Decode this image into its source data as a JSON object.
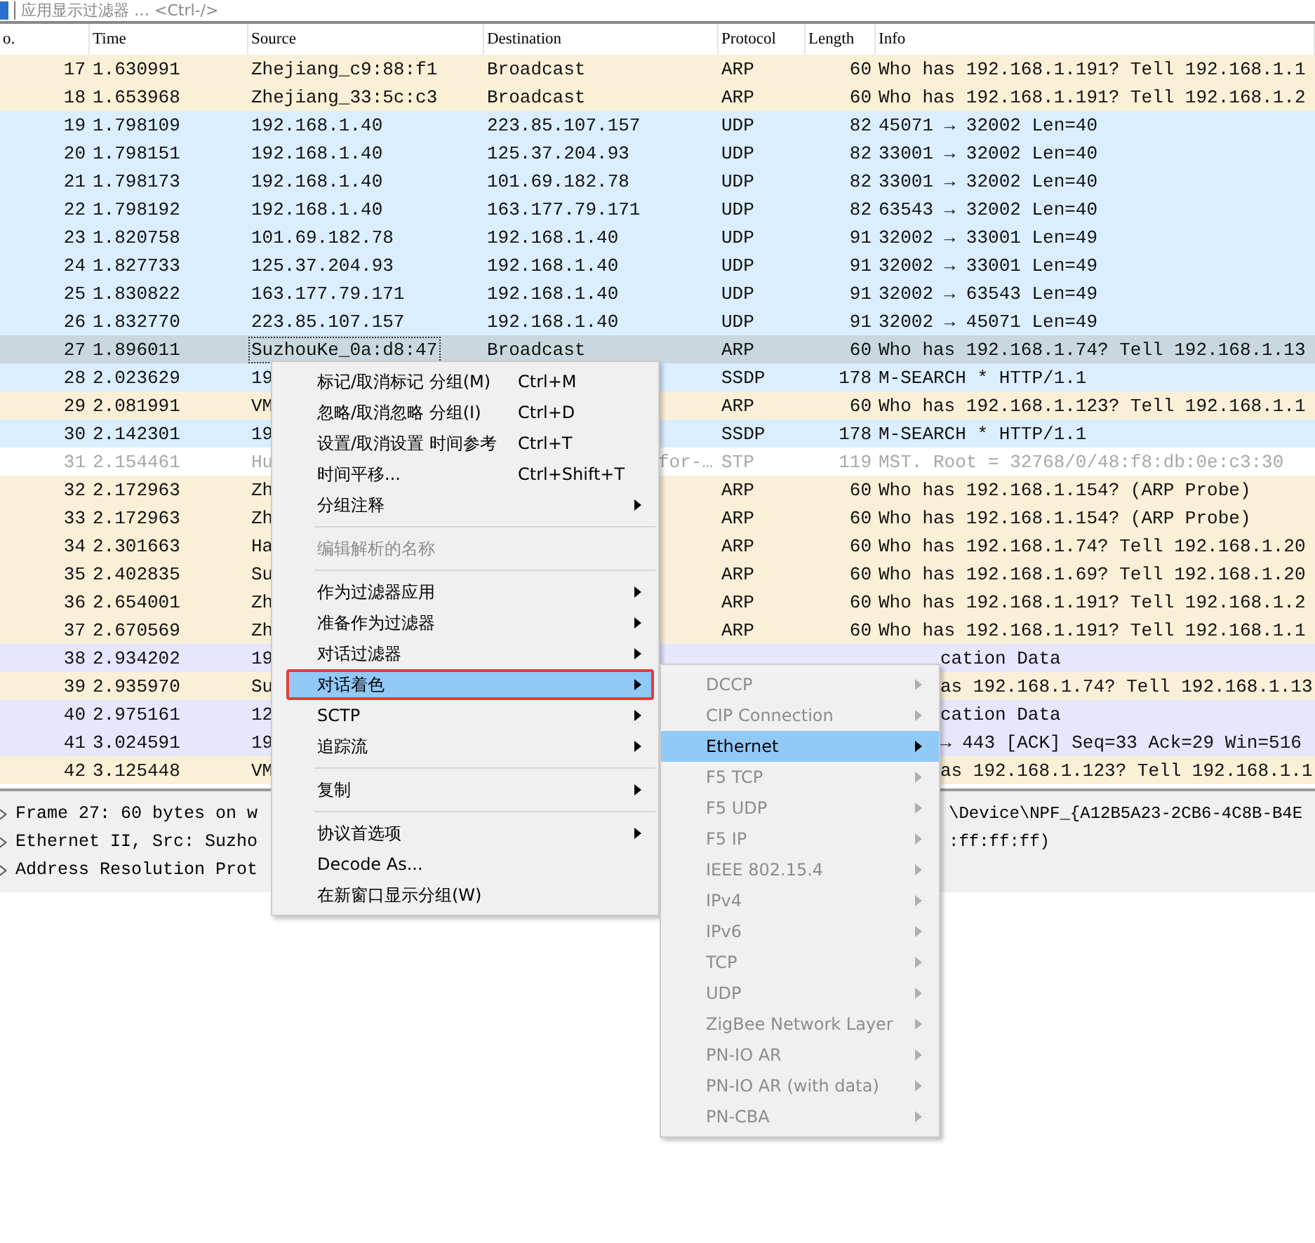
{
  "filter": {
    "placeholder": "应用显示过滤器 … <Ctrl-/>"
  },
  "columns": [
    "o.",
    "Time",
    "Source",
    "Destination",
    "Protocol",
    "Length",
    "Info"
  ],
  "rows": [
    {
      "no": "17",
      "time": "1.630991",
      "source": "Zhejiang_c9:88:f1",
      "destination": "Broadcast",
      "protocol": "ARP",
      "length": "60",
      "info": "Who has 192.168.1.191? Tell 192.168.1.1",
      "color": "#faf0d7",
      "selected": false,
      "dimmed": false
    },
    {
      "no": "18",
      "time": "1.653968",
      "source": "Zhejiang_33:5c:c3",
      "destination": "Broadcast",
      "protocol": "ARP",
      "length": "60",
      "info": "Who has 192.168.1.191? Tell 192.168.1.2",
      "color": "#faf0d7",
      "selected": false,
      "dimmed": false
    },
    {
      "no": "19",
      "time": "1.798109",
      "source": "192.168.1.40",
      "destination": "223.85.107.157",
      "protocol": "UDP",
      "length": "82",
      "info": "45071 → 32002 Len=40",
      "color": "#daeeff",
      "selected": false,
      "dimmed": false
    },
    {
      "no": "20",
      "time": "1.798151",
      "source": "192.168.1.40",
      "destination": "125.37.204.93",
      "protocol": "UDP",
      "length": "82",
      "info": "33001 → 32002 Len=40",
      "color": "#daeeff",
      "selected": false,
      "dimmed": false
    },
    {
      "no": "21",
      "time": "1.798173",
      "source": "192.168.1.40",
      "destination": "101.69.182.78",
      "protocol": "UDP",
      "length": "82",
      "info": "33001 → 32002 Len=40",
      "color": "#daeeff",
      "selected": false,
      "dimmed": false
    },
    {
      "no": "22",
      "time": "1.798192",
      "source": "192.168.1.40",
      "destination": "163.177.79.171",
      "protocol": "UDP",
      "length": "82",
      "info": "63543 → 32002 Len=40",
      "color": "#daeeff",
      "selected": false,
      "dimmed": false
    },
    {
      "no": "23",
      "time": "1.820758",
      "source": "101.69.182.78",
      "destination": "192.168.1.40",
      "protocol": "UDP",
      "length": "91",
      "info": "32002 → 33001 Len=49",
      "color": "#daeeff",
      "selected": false,
      "dimmed": false
    },
    {
      "no": "24",
      "time": "1.827733",
      "source": "125.37.204.93",
      "destination": "192.168.1.40",
      "protocol": "UDP",
      "length": "91",
      "info": "32002 → 33001 Len=49",
      "color": "#daeeff",
      "selected": false,
      "dimmed": false
    },
    {
      "no": "25",
      "time": "1.830822",
      "source": "163.177.79.171",
      "destination": "192.168.1.40",
      "protocol": "UDP",
      "length": "91",
      "info": "32002 → 63543 Len=49",
      "color": "#daeeff",
      "selected": false,
      "dimmed": false
    },
    {
      "no": "26",
      "time": "1.832770",
      "source": "223.85.107.157",
      "destination": "192.168.1.40",
      "protocol": "UDP",
      "length": "91",
      "info": "32002 → 45071 Len=49",
      "color": "#daeeff",
      "selected": false,
      "dimmed": false
    },
    {
      "no": "27",
      "time": "1.896011",
      "source": "SuzhouKe_0a:d8:47",
      "destination": "Broadcast",
      "protocol": "ARP",
      "length": "60",
      "info": "Who has 192.168.1.74? Tell 192.168.1.13",
      "color": "#c9d8df",
      "selected": true,
      "dimmed": false
    },
    {
      "no": "28",
      "time": "2.023629",
      "source": "19",
      "protocol": "SSDP",
      "length": "178",
      "info": "M-SEARCH * HTTP/1.1",
      "color": "#daeeff",
      "selected": false,
      "dimmed": false
    },
    {
      "no": "29",
      "time": "2.081991",
      "source": "VM",
      "protocol": "ARP",
      "length": "60",
      "info": "Who has 192.168.1.123? Tell 192.168.1.1",
      "color": "#faf0d7",
      "selected": false,
      "dimmed": false
    },
    {
      "no": "30",
      "time": "2.142301",
      "source": "19",
      "protocol": "SSDP",
      "length": "178",
      "info": "M-SEARCH * HTTP/1.1",
      "color": "#daeeff",
      "selected": false,
      "dimmed": false
    },
    {
      "no": "31",
      "time": "2.154461",
      "source": "Hu",
      "destination_tail": "for-…",
      "protocol": "STP",
      "length": "119",
      "info": "MST. Root = 32768/0/48:f8:db:0e:c3:30",
      "color": "#ffffff",
      "selected": false,
      "dimmed": true
    },
    {
      "no": "32",
      "time": "2.172963",
      "source": "Zh",
      "protocol": "ARP",
      "length": "60",
      "info": "Who has 192.168.1.154? (ARP Probe)",
      "color": "#faf0d7",
      "selected": false,
      "dimmed": false
    },
    {
      "no": "33",
      "time": "2.172963",
      "source": "Zh",
      "protocol": "ARP",
      "length": "60",
      "info": "Who has 192.168.1.154? (ARP Probe)",
      "color": "#faf0d7",
      "selected": false,
      "dimmed": false
    },
    {
      "no": "34",
      "time": "2.301663",
      "source": "Ha",
      "protocol": "ARP",
      "length": "60",
      "info": "Who has 192.168.1.74? Tell 192.168.1.20",
      "color": "#faf0d7",
      "selected": false,
      "dimmed": false
    },
    {
      "no": "35",
      "time": "2.402835",
      "source": "Su",
      "protocol": "ARP",
      "length": "60",
      "info": "Who has 192.168.1.69? Tell 192.168.1.20",
      "color": "#faf0d7",
      "selected": false,
      "dimmed": false
    },
    {
      "no": "36",
      "time": "2.654001",
      "source": "Zh",
      "protocol": "ARP",
      "length": "60",
      "info": "Who has 192.168.1.191? Tell 192.168.1.2",
      "color": "#faf0d7",
      "selected": false,
      "dimmed": false
    },
    {
      "no": "37",
      "time": "2.670569",
      "source": "Zh",
      "protocol": "ARP",
      "length": "60",
      "info": "Who has 192.168.1.191? Tell 192.168.1.1",
      "color": "#faf0d7",
      "selected": false,
      "dimmed": false
    },
    {
      "no": "38",
      "time": "2.934202",
      "source": "19",
      "info_tail": "cation Data",
      "color": "#e7e6ff",
      "selected": false,
      "dimmed": false
    },
    {
      "no": "39",
      "time": "2.935970",
      "source": "Su",
      "info_tail": "as 192.168.1.74? Tell 192.168.1.13",
      "color": "#faf0d7",
      "selected": false,
      "dimmed": false
    },
    {
      "no": "40",
      "time": "2.975161",
      "source": "12",
      "info_tail": "cation Data",
      "color": "#e7e6ff",
      "selected": false,
      "dimmed": false
    },
    {
      "no": "41",
      "time": "3.024591",
      "source": "19",
      "info_tail": "→ 443 [ACK] Seq=33 Ack=29 Win=516",
      "color": "#e7e6ff",
      "selected": false,
      "dimmed": false
    },
    {
      "no": "42",
      "time": "3.125448",
      "source": "VM",
      "info_tail": "as 192.168.1.123? Tell 192.168.1.1",
      "color": "#faf0d7",
      "selected": false,
      "dimmed": false
    }
  ],
  "details": [
    {
      "text": "Frame 27: 60 bytes on w",
      "tail": "\\Device\\NPF_{A12B5A23-2CB6-4C8B-B4E"
    },
    {
      "text": "Ethernet II, Src: Suzho",
      "tail": ":ff:ff:ff)"
    },
    {
      "text": "Address Resolution Prot"
    }
  ],
  "context_menu": {
    "items": [
      {
        "kind": "action",
        "label": "标记/取消标记 分组(M)",
        "shortcut": "Ctrl+M",
        "disabled": false,
        "selected": false
      },
      {
        "kind": "action",
        "label": "忽略/取消忽略 分组(I)",
        "shortcut": "Ctrl+D",
        "disabled": false,
        "selected": false
      },
      {
        "kind": "action",
        "label": "设置/取消设置 时间参考",
        "shortcut": "Ctrl+T",
        "disabled": false,
        "selected": false
      },
      {
        "kind": "action",
        "label": "时间平移...",
        "shortcut": "Ctrl+Shift+T",
        "disabled": false,
        "selected": false
      },
      {
        "kind": "submenu",
        "label": "分组注释",
        "disabled": false,
        "selected": false
      },
      {
        "kind": "separator"
      },
      {
        "kind": "action",
        "label": "编辑解析的名称",
        "disabled": true,
        "selected": false
      },
      {
        "kind": "separator"
      },
      {
        "kind": "submenu",
        "label": "作为过滤器应用",
        "disabled": false,
        "selected": false
      },
      {
        "kind": "submenu",
        "label": "准备作为过滤器",
        "disabled": false,
        "selected": false
      },
      {
        "kind": "submenu",
        "label": "对话过滤器",
        "disabled": false,
        "selected": false
      },
      {
        "kind": "submenu",
        "label": "对话着色",
        "disabled": false,
        "selected": true
      },
      {
        "kind": "submenu",
        "label": "SCTP",
        "disabled": false,
        "selected": false
      },
      {
        "kind": "submenu",
        "label": "追踪流",
        "disabled": false,
        "selected": false
      },
      {
        "kind": "separator"
      },
      {
        "kind": "submenu",
        "label": "复制",
        "disabled": false,
        "selected": false
      },
      {
        "kind": "separator"
      },
      {
        "kind": "submenu",
        "label": "协议首选项",
        "disabled": false,
        "selected": false
      },
      {
        "kind": "action",
        "label": "Decode As...",
        "disabled": false,
        "selected": false
      },
      {
        "kind": "action",
        "label": "在新窗口显示分组(W)",
        "disabled": false,
        "selected": false
      }
    ]
  },
  "submenu": {
    "items": [
      {
        "label": "DCCP",
        "disabled": true,
        "selected": false
      },
      {
        "label": "CIP Connection",
        "disabled": true,
        "selected": false
      },
      {
        "label": "Ethernet",
        "disabled": false,
        "selected": true
      },
      {
        "label": "F5 TCP",
        "disabled": true,
        "selected": false
      },
      {
        "label": "F5 UDP",
        "disabled": true,
        "selected": false
      },
      {
        "label": "F5 IP",
        "disabled": true,
        "selected": false
      },
      {
        "label": "IEEE 802.15.4",
        "disabled": true,
        "selected": false
      },
      {
        "label": "IPv4",
        "disabled": true,
        "selected": false
      },
      {
        "label": "IPv6",
        "disabled": true,
        "selected": false
      },
      {
        "label": "TCP",
        "disabled": true,
        "selected": false
      },
      {
        "label": "UDP",
        "disabled": true,
        "selected": false
      },
      {
        "label": "ZigBee Network Layer",
        "disabled": true,
        "selected": false
      },
      {
        "label": "PN-IO AR",
        "disabled": true,
        "selected": false
      },
      {
        "label": "PN-IO AR (with data)",
        "disabled": true,
        "selected": false
      },
      {
        "label": "PN-CBA",
        "disabled": true,
        "selected": false
      }
    ]
  }
}
